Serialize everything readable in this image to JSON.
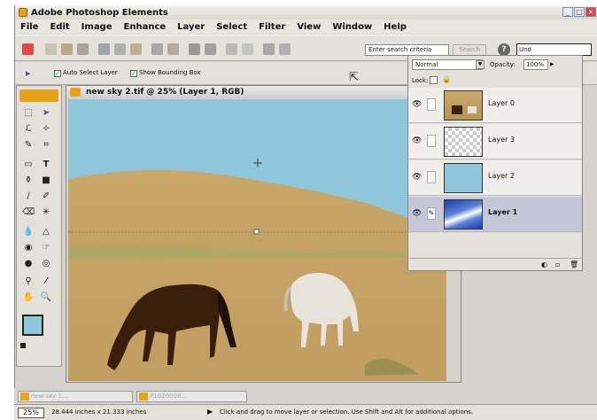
{
  "app": {
    "title": "Adobe Photoshop Elements",
    "accent": "#e8a21a"
  },
  "menu": [
    "File",
    "Edit",
    "Image",
    "Enhance",
    "Layer",
    "Select",
    "Filter",
    "View",
    "Window",
    "Help"
  ],
  "toolbar": {
    "search_placeholder": "Enter search criteria",
    "search_button": "Search",
    "help_icon": "?",
    "undo_label": "Und"
  },
  "options_bar": {
    "auto_select_label": "Auto Select Layer",
    "show_bounding_label": "Show Bounding Box",
    "auto_select_checked": true,
    "show_bounding_checked": true
  },
  "document": {
    "title": "new sky 2.tif @ 25% (Layer 1, RGB)",
    "sky_color": "#8ec7dc",
    "field_color": "#c9a86a"
  },
  "layers_panel": {
    "blend_mode": "Normal",
    "opacity_label": "Opacity:",
    "opacity_value": "100%",
    "lock_label": "Lock:",
    "layers": [
      {
        "name": "Layer 0",
        "thumb": "horses"
      },
      {
        "name": "Layer 3",
        "thumb": "transparent"
      },
      {
        "name": "Layer 2",
        "thumb": "sky-solid"
      },
      {
        "name": "Layer 1",
        "thumb": "sky-gradient",
        "active": true
      }
    ]
  },
  "taskbar": {
    "tasks": [
      "new sky 1...",
      "P1020008..."
    ]
  },
  "status": {
    "zoom": "25%",
    "doc_size": "28.444 inches x 21.333 inches",
    "hint": "Click and drag to move layer or selection. Use Shift and Alt for additional options."
  }
}
